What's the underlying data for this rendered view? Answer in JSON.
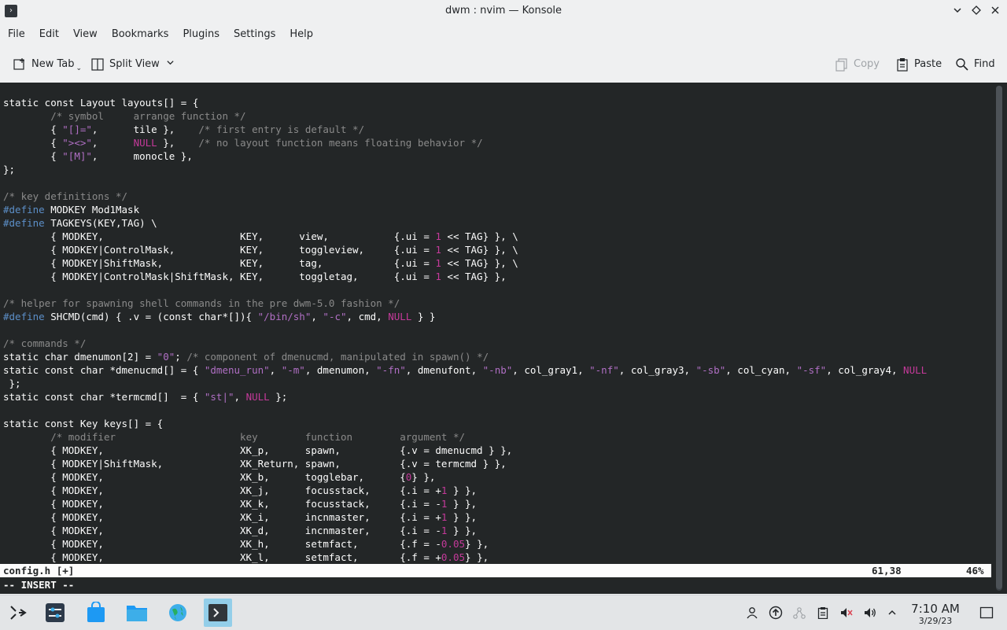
{
  "window": {
    "title": "dwm : nvim — Konsole",
    "app_icon": "terminal-icon",
    "controls": [
      "chevron-down-icon",
      "diamond-icon",
      "close-icon"
    ]
  },
  "menu": [
    "File",
    "Edit",
    "View",
    "Bookmarks",
    "Plugins",
    "Settings",
    "Help"
  ],
  "toolbar": {
    "new_tab": "New Tab",
    "split_view": "Split View",
    "copy": "Copy",
    "paste": "Paste",
    "find": "Find"
  },
  "editor": {
    "lines": [
      [
        [
          "k",
          "static const Layout layouts[] = {"
        ]
      ],
      [
        [
          "k",
          "        "
        ],
        [
          "c",
          "/* symbol     arrange function */"
        ]
      ],
      [
        [
          "k",
          "        { "
        ],
        [
          "s",
          "\"[]=\""
        ],
        [
          "k",
          ",      tile },    "
        ],
        [
          "c",
          "/* first entry is default */"
        ]
      ],
      [
        [
          "k",
          "        { "
        ],
        [
          "s",
          "\"><>\""
        ],
        [
          "k",
          ",      "
        ],
        [
          "n",
          "NULL"
        ],
        [
          "k",
          " },    "
        ],
        [
          "c",
          "/* no layout function means floating behavior */"
        ]
      ],
      [
        [
          "k",
          "        { "
        ],
        [
          "s",
          "\"[M]\""
        ],
        [
          "k",
          ",      monocle },"
        ]
      ],
      [
        [
          "k",
          "};"
        ]
      ],
      [
        [
          "k",
          ""
        ]
      ],
      [
        [
          "c",
          "/* key definitions */"
        ]
      ],
      [
        [
          "p",
          "#define"
        ],
        [
          "k",
          " MODKEY Mod1Mask"
        ]
      ],
      [
        [
          "p",
          "#define"
        ],
        [
          "k",
          " TAGKEYS(KEY,TAG) \\"
        ]
      ],
      [
        [
          "k",
          "        { MODKEY,                       KEY,      view,           {.ui = "
        ],
        [
          "n",
          "1"
        ],
        [
          "k",
          " << TAG} }, \\"
        ]
      ],
      [
        [
          "k",
          "        { MODKEY|ControlMask,           KEY,      toggleview,     {.ui = "
        ],
        [
          "n",
          "1"
        ],
        [
          "k",
          " << TAG} }, \\"
        ]
      ],
      [
        [
          "k",
          "        { MODKEY|ShiftMask,             KEY,      tag,            {.ui = "
        ],
        [
          "n",
          "1"
        ],
        [
          "k",
          " << TAG} }, \\"
        ]
      ],
      [
        [
          "k",
          "        { MODKEY|ControlMask|ShiftMask, KEY,      toggletag,      {.ui = "
        ],
        [
          "n",
          "1"
        ],
        [
          "k",
          " << TAG} },"
        ]
      ],
      [
        [
          "k",
          ""
        ]
      ],
      [
        [
          "c",
          "/* helper for spawning shell commands in the pre dwm-5.0 fashion */"
        ]
      ],
      [
        [
          "p",
          "#define"
        ],
        [
          "k",
          " SHCMD(cmd) { .v = (const char*[]){ "
        ],
        [
          "s",
          "\"/bin/sh\""
        ],
        [
          "k",
          ", "
        ],
        [
          "s",
          "\"-c\""
        ],
        [
          "k",
          ", cmd, "
        ],
        [
          "n",
          "NULL"
        ],
        [
          "k",
          " } }"
        ]
      ],
      [
        [
          "k",
          ""
        ]
      ],
      [
        [
          "c",
          "/* commands */"
        ]
      ],
      [
        [
          "k",
          "static char dmenumon[2] = "
        ],
        [
          "s",
          "\"0\""
        ],
        [
          "k",
          "; "
        ],
        [
          "c",
          "/* component of dmenucmd, manipulated in spawn() */"
        ]
      ],
      [
        [
          "k",
          "static const char *dmenucmd[] = { "
        ],
        [
          "s",
          "\"dmenu_run\""
        ],
        [
          "k",
          ", "
        ],
        [
          "s",
          "\"-m\""
        ],
        [
          "k",
          ", dmenumon, "
        ],
        [
          "s",
          "\"-fn\""
        ],
        [
          "k",
          ", dmenufont, "
        ],
        [
          "s",
          "\"-nb\""
        ],
        [
          "k",
          ", col_gray1, "
        ],
        [
          "s",
          "\"-nf\""
        ],
        [
          "k",
          ", col_gray3, "
        ],
        [
          "s",
          "\"-sb\""
        ],
        [
          "k",
          ", col_cyan, "
        ],
        [
          "s",
          "\"-sf\""
        ],
        [
          "k",
          ", col_gray4, "
        ],
        [
          "n",
          "NULL"
        ]
      ],
      [
        [
          "k",
          " };"
        ]
      ],
      [
        [
          "k",
          "static const char *termcmd[]  = { "
        ],
        [
          "s",
          "\"st|\""
        ],
        [
          "k",
          ", "
        ],
        [
          "n",
          "NULL"
        ],
        [
          "k",
          " };"
        ]
      ],
      [
        [
          "k",
          ""
        ]
      ],
      [
        [
          "k",
          "static const Key keys[] = {"
        ]
      ],
      [
        [
          "k",
          "        "
        ],
        [
          "c",
          "/* modifier                     key        function        argument */"
        ]
      ],
      [
        [
          "k",
          "        { MODKEY,                       XK_p,      spawn,          {.v = dmenucmd } },"
        ]
      ],
      [
        [
          "k",
          "        { MODKEY|ShiftMask,             XK_Return, spawn,          {.v = termcmd } },"
        ]
      ],
      [
        [
          "k",
          "        { MODKEY,                       XK_b,      togglebar,      {"
        ],
        [
          "n",
          "0"
        ],
        [
          "k",
          "} },"
        ]
      ],
      [
        [
          "k",
          "        { MODKEY,                       XK_j,      focusstack,     {.i = +"
        ],
        [
          "n",
          "1"
        ],
        [
          "k",
          " } },"
        ]
      ],
      [
        [
          "k",
          "        { MODKEY,                       XK_k,      focusstack,     {.i = -"
        ],
        [
          "n",
          "1"
        ],
        [
          "k",
          " } },"
        ]
      ],
      [
        [
          "k",
          "        { MODKEY,                       XK_i,      incnmaster,     {.i = +"
        ],
        [
          "n",
          "1"
        ],
        [
          "k",
          " } },"
        ]
      ],
      [
        [
          "k",
          "        { MODKEY,                       XK_d,      incnmaster,     {.i = -"
        ],
        [
          "n",
          "1"
        ],
        [
          "k",
          " } },"
        ]
      ],
      [
        [
          "k",
          "        { MODKEY,                       XK_h,      setmfact,       {.f = -"
        ],
        [
          "n",
          "0.05"
        ],
        [
          "k",
          "} },"
        ]
      ],
      [
        [
          "k",
          "        { MODKEY,                       XK_l,      setmfact,       {.f = +"
        ],
        [
          "n",
          "0.05"
        ],
        [
          "k",
          "} },"
        ]
      ]
    ],
    "status_file": "config.h [+]",
    "status_pos": "61,38",
    "status_pct": "46%",
    "mode": "-- INSERT --"
  },
  "taskbar": {
    "clock_time": "7:10 AM",
    "clock_date": "3/29/23"
  }
}
